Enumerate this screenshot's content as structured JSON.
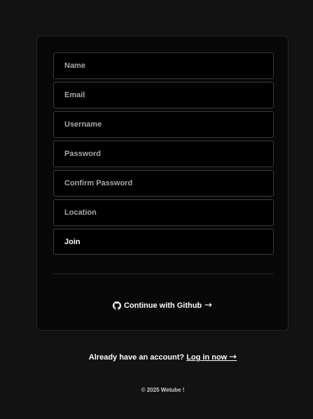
{
  "form": {
    "name_placeholder": "Name",
    "email_placeholder": "Email",
    "username_placeholder": "Username",
    "password_placeholder": "Password",
    "confirm_password_placeholder": "Confirm Password",
    "location_placeholder": "Location",
    "join_label": "Join"
  },
  "social": {
    "github_label": "Continue with Github",
    "github_arrow": "→",
    "icon": "github-icon"
  },
  "login_prompt": {
    "text": "Already have an account?",
    "link_label": "Log in now",
    "arrow": "→"
  },
  "footer": {
    "copyright": "© 2025 Wetube !"
  }
}
